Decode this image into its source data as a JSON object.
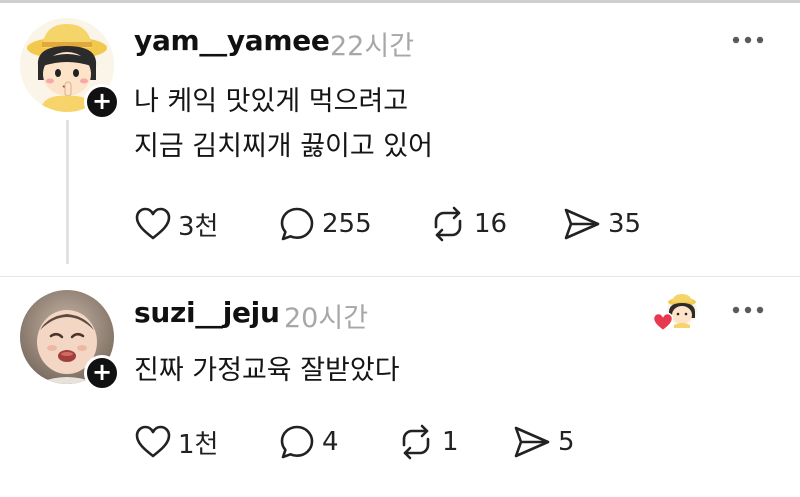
{
  "posts": [
    {
      "username": "yam__yamee",
      "time": "22시간",
      "lines": [
        "나 케익 맛있게 먹으려고",
        "지금 김치찌개 끓이고 있어"
      ],
      "likes": "3천",
      "replies": "255",
      "reposts": "16",
      "shares": "35"
    },
    {
      "username": "suzi__jeju",
      "time": "20시간",
      "lines": [
        "진짜 가정교육 잘받았다"
      ],
      "likes": "1천",
      "replies": "4",
      "reposts": "1",
      "shares": "5"
    }
  ],
  "plus_symbol": "+",
  "icons": {
    "like": "heart-icon",
    "reply": "comment-bubble-icon",
    "repost": "repost-arrows-icon",
    "share": "send-icon",
    "more": "more-dots-icon",
    "liked_by_author": "red-heart-icon"
  },
  "colors": {
    "text": "#111111",
    "muted": "#a7a7a7",
    "heart": "#e8384f"
  }
}
